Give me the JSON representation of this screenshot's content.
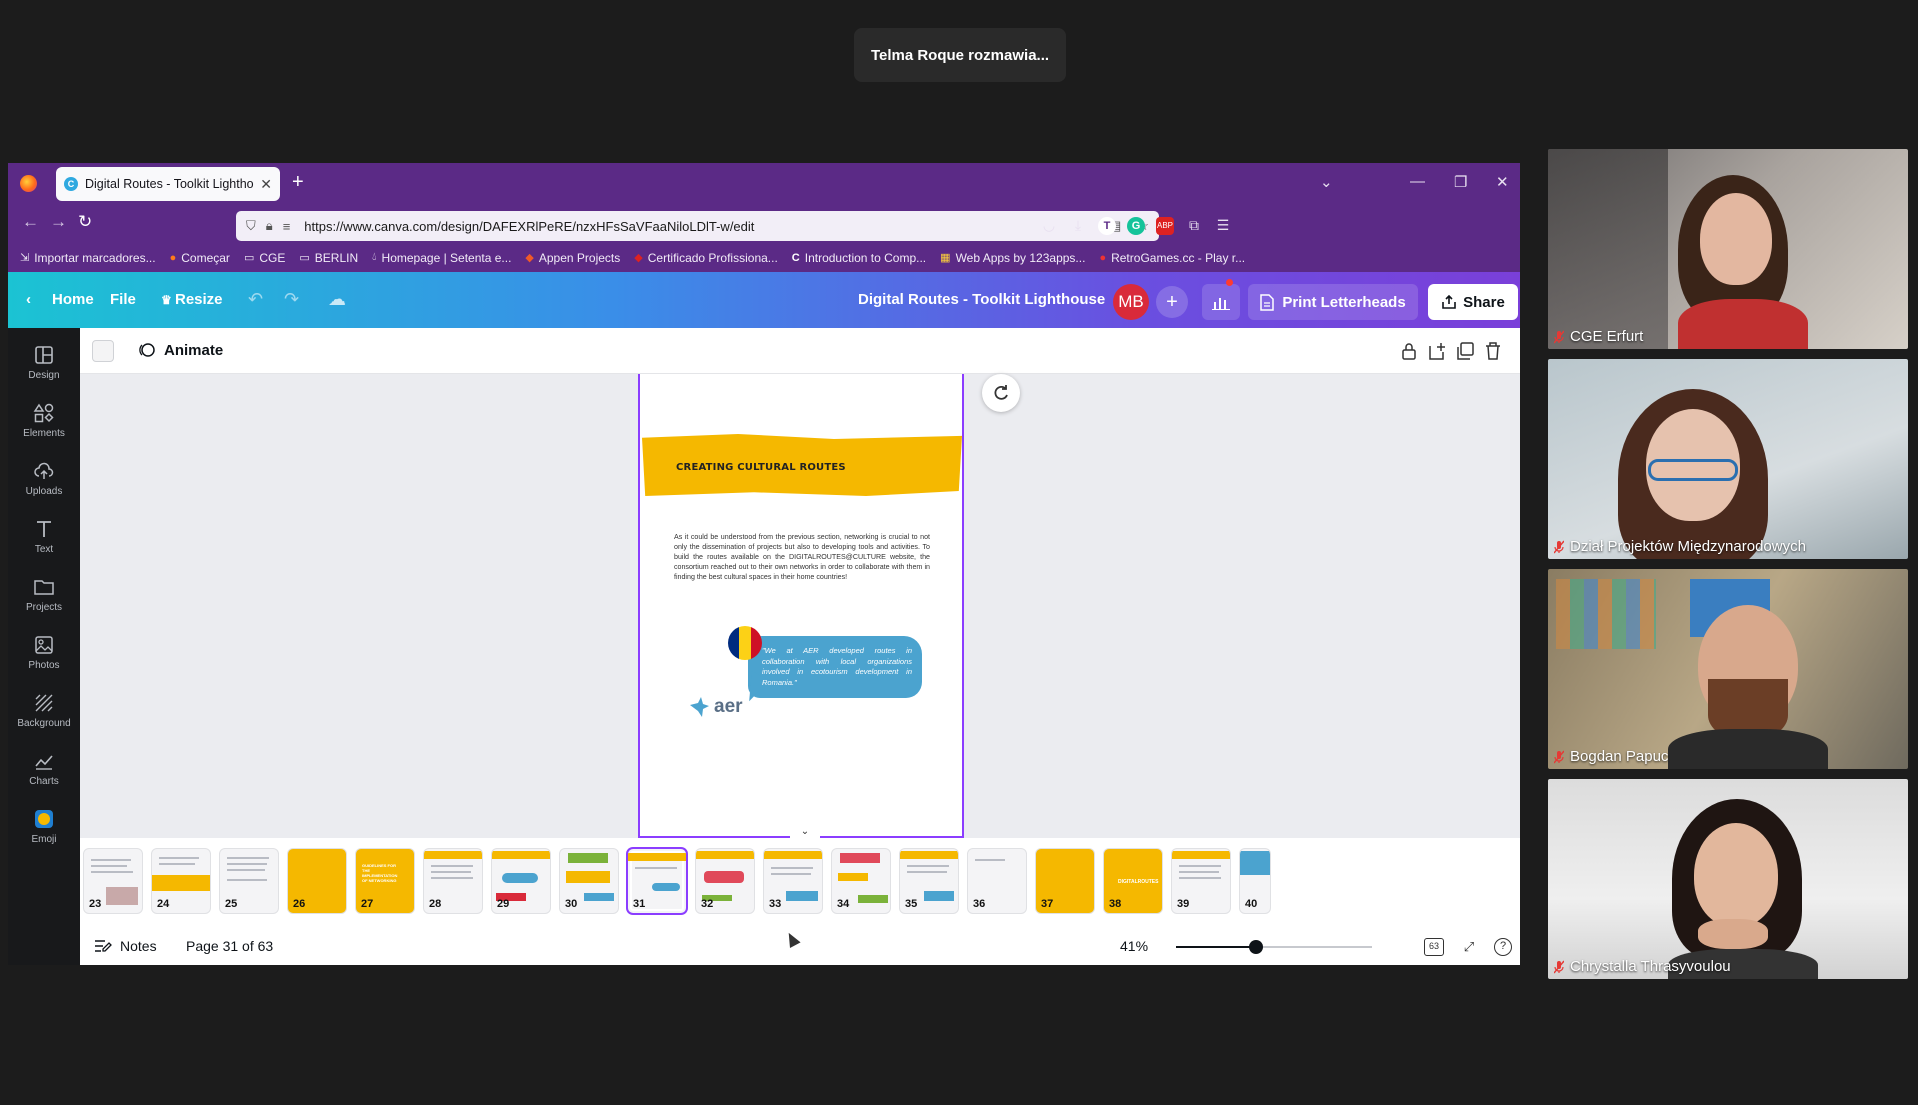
{
  "meeting": {
    "speaking_banner": "Telma Roque rozmawia..."
  },
  "browser": {
    "tab_title": "Digital Routes - Toolkit Lightho",
    "url": "https://www.canva.com/design/DAFEXRlPeRE/nzxHFsSaVFaaNiloLDlT-w/edit",
    "bookmarks": [
      "Importar marcadores...",
      "Começar",
      "CGE",
      "BERLIN",
      "Homepage | Setenta e...",
      "Appen Projects",
      "Certificado Profissiona...",
      "Introduction to Comp...",
      "Web Apps by 123apps...",
      "RetroGames.cc - Play r..."
    ]
  },
  "canva": {
    "header": {
      "home": "Home",
      "file": "File",
      "resize": "Resize",
      "doc_title": "Digital Routes - Toolkit Lighthouse",
      "avatar_initials": "MB",
      "print_label": "Print Letterheads",
      "share_label": "Share"
    },
    "rail": [
      "Design",
      "Elements",
      "Uploads",
      "Text",
      "Projects",
      "Photos",
      "Background",
      "Charts",
      "Emoji"
    ],
    "toolbar": {
      "animate": "Animate"
    },
    "page": {
      "heading": "CREATING CULTURAL ROUTES",
      "paragraph": "As it could be understood from the previous section, networking is crucial to not only the dissemination of projects but also to developing tools and activities. To build the routes available on the DIGITALROUTES@CULTURE website, the consortium reached out to their own networks in order to collaborate with them in finding the best cultural spaces in their home countries!",
      "quote": "\"We at AER developed routes in collaboration with local organizations involved in ecotourism development in Romania.\"",
      "logo_word": "aer"
    },
    "thumbnails": [
      "23",
      "24",
      "25",
      "26",
      "27",
      "28",
      "29",
      "30",
      "31",
      "32",
      "33",
      "34",
      "35",
      "36",
      "37",
      "38",
      "39",
      "40"
    ],
    "thumb_texts": {
      "t27": "GUIDELINES FOR THE IMPLEMENTATION OF NETWORKING",
      "t38": "DIGITALROUTES"
    },
    "footer": {
      "notes": "Notes",
      "page_info": "Page 31 of 63",
      "zoom": "41%",
      "zoom_fraction": 0.41,
      "page_count_badge": "63"
    },
    "colors": {
      "accent": "#8b3dff",
      "yellow": "#f5b800",
      "bubble": "#4ba3cf"
    }
  },
  "participants": [
    {
      "name": "CGE Erfurt"
    },
    {
      "name": "Dział Projektów Międzynarodowych"
    },
    {
      "name": "Bogdan Papuc"
    },
    {
      "name": "Chrystalla Thrasyvoulou"
    }
  ]
}
